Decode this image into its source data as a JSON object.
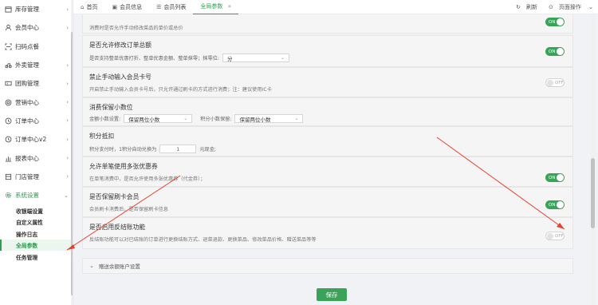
{
  "sidebar": {
    "items": [
      {
        "label": "库存管理",
        "icon": "box-icon"
      },
      {
        "label": "会员中心",
        "icon": "user-icon"
      },
      {
        "label": "扫码点餐",
        "icon": "scan-icon"
      },
      {
        "label": "外卖管理",
        "icon": "bike-icon"
      },
      {
        "label": "团购管理",
        "icon": "coupon-icon"
      },
      {
        "label": "营销中心",
        "icon": "target-icon"
      },
      {
        "label": "订单中心",
        "icon": "order-icon"
      },
      {
        "label": "订单中心v2",
        "icon": "order-v2-icon"
      },
      {
        "label": "报表中心",
        "icon": "chart-icon"
      },
      {
        "label": "门店管理",
        "icon": "store-icon"
      },
      {
        "label": "系统设置",
        "icon": "gear-icon"
      }
    ],
    "subitems": [
      {
        "label": "收银端设置"
      },
      {
        "label": "自定义属性"
      },
      {
        "label": "操作日志"
      },
      {
        "label": "全局参数"
      },
      {
        "label": "任务管理"
      }
    ]
  },
  "tabs": [
    {
      "label": "首页",
      "icon": "home-icon"
    },
    {
      "label": "会员信息",
      "icon": "member-icon"
    },
    {
      "label": "会员列表",
      "icon": "list-icon"
    },
    {
      "label": "全局参数",
      "icon": ""
    }
  ],
  "topbar": {
    "refresh": "刷新",
    "page_ops": "页面操作"
  },
  "settings": {
    "s0": {
      "desc": "消费时是否允许手动修改菜品的单价或总价",
      "toggle": "ON"
    },
    "s1": {
      "title": "是否允许修改订单总额",
      "desc": "是否支持整单优惠打折、整单优惠金额、整单抹零；抹零位:",
      "select": "分",
      "toggle": "ON"
    },
    "s2": {
      "title": "禁止手动输入会员卡号",
      "desc": "开启禁止手动输入会员卡号后，只允许通过刷卡的方式进行消费；注：建议使用IC卡",
      "toggle": "OFF"
    },
    "s3": {
      "title": "消费保留小数位",
      "label_amount": "金额小数设置:",
      "select_amount": "保留两位小数",
      "label_points": "积分小数保留:",
      "select_points": "保留两位小数"
    },
    "s4": {
      "title": "积分抵扣",
      "pre": "积分支付时，1积分自动兑换为",
      "value": "1",
      "post": "元现金;"
    },
    "s5": {
      "title": "允许单笔使用多张优惠券",
      "desc": "在单笔消费中，是否允许使用多张优惠券（代金券）；",
      "toggle": "ON"
    },
    "s6": {
      "title": "是否保留刷卡会员",
      "desc": "会员刷卡消费后，是否保留刷卡信息",
      "toggle": "ON"
    },
    "s7": {
      "title": "是否启用反结账功能",
      "desc": "反结账功能可以对已结账的订单进行更换结账方式、退菜退款、更换菜品、修改菜品价格、赠送菜品等等",
      "toggle": "OFF"
    }
  },
  "collapse_section": {
    "label": "赠送余额账户设置"
  },
  "save_label": "保存",
  "colors": {
    "accent": "#3aa35a",
    "arrow": "#e8412e"
  }
}
